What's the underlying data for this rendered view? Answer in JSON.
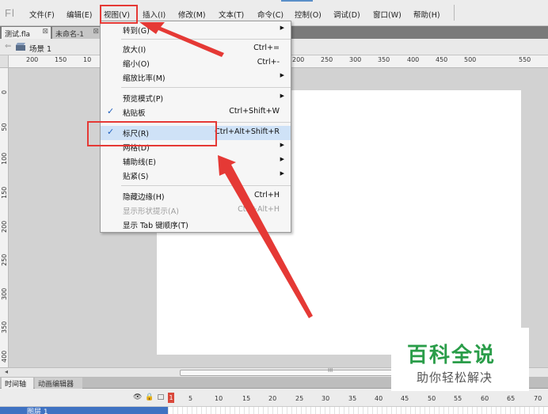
{
  "app": {
    "logo": "Fl"
  },
  "menubar": [
    {
      "label": "文件(F)"
    },
    {
      "label": "编辑(E)"
    },
    {
      "label": "视图(V)"
    },
    {
      "label": "插入(I)"
    },
    {
      "label": "修改(M)"
    },
    {
      "label": "文本(T)"
    },
    {
      "label": "命令(C)"
    },
    {
      "label": "控制(O)"
    },
    {
      "label": "调试(D)"
    },
    {
      "label": "窗口(W)"
    },
    {
      "label": "帮助(H)"
    }
  ],
  "doc_tabs": [
    {
      "label": "测试.fla",
      "close": "⊠"
    },
    {
      "label": "未命名-1",
      "close": "⊠"
    }
  ],
  "scene": {
    "back": "⇐",
    "label": "场景 1"
  },
  "ruler": {
    "h_labels": [
      "200",
      "150",
      "10",
      "200",
      "250",
      "300",
      "350",
      "400",
      "450",
      "500",
      "550"
    ],
    "v_labels": [
      "0",
      "50",
      "100",
      "150",
      "200",
      "250",
      "300",
      "350",
      "400"
    ]
  },
  "view_menu": {
    "items": [
      {
        "label": "转到(G)",
        "shortcut": "",
        "submenu": true
      },
      {
        "label": "放大(I)",
        "shortcut": "Ctrl+=",
        "submenu": false
      },
      {
        "label": "缩小(O)",
        "shortcut": "Ctrl+-",
        "submenu": false
      },
      {
        "label": "缩放比率(M)",
        "shortcut": "",
        "submenu": true
      },
      {
        "label": "预览模式(P)",
        "shortcut": "",
        "submenu": true
      },
      {
        "label": "粘贴板",
        "shortcut": "Ctrl+Shift+W",
        "checked": true
      },
      {
        "label": "标尺(R)",
        "shortcut": "Ctrl+Alt+Shift+R",
        "checked": true
      },
      {
        "label": "网格(D)",
        "shortcut": "",
        "submenu": true
      },
      {
        "label": "辅助线(E)",
        "shortcut": "",
        "submenu": true
      },
      {
        "label": "贴紧(S)",
        "shortcut": "",
        "submenu": true
      },
      {
        "label": "隐藏边缘(H)",
        "shortcut": "Ctrl+H"
      },
      {
        "label": "显示形状提示(A)",
        "shortcut": "Ctrl+Alt+H",
        "disabled": true
      },
      {
        "label": "显示 Tab 键顺序(T)",
        "shortcut": ""
      }
    ],
    "check_glyph": "✓",
    "submenu_glyph": "▶"
  },
  "panel_tabs": [
    {
      "label": "时间轴"
    },
    {
      "label": "动画编辑器"
    }
  ],
  "timeline": {
    "icons": "👁🔒□",
    "playhead": "1",
    "frame_numbers": [
      "5",
      "10",
      "15",
      "20",
      "25",
      "30",
      "35",
      "40",
      "45",
      "50",
      "55",
      "60",
      "65",
      "70"
    ],
    "layer_name": "图层 1"
  },
  "scroll": {
    "grip": "III",
    "left": "◂"
  },
  "watermark": {
    "title": "百科全说",
    "subtitle": "助你轻松解决"
  },
  "colors": {
    "highlight": "#e53935",
    "watermark_green": "#2a9d49",
    "check": "#1f5fbf"
  }
}
